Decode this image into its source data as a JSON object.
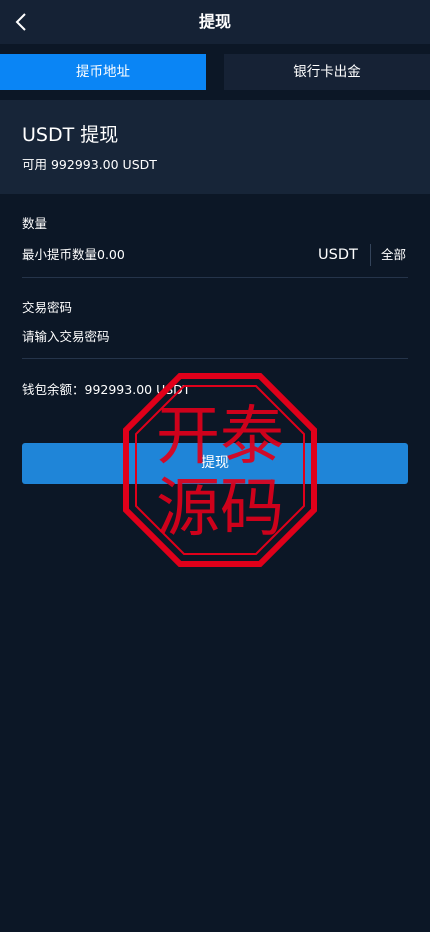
{
  "header": {
    "title": "提现"
  },
  "tabs": [
    {
      "label": "提币地址",
      "active": true
    },
    {
      "label": "银行卡出金",
      "active": false
    }
  ],
  "summary": {
    "title": "USDT 提现",
    "available": "可用 992993.00 USDT"
  },
  "amount": {
    "label": "数量",
    "placeholder": "最小提币数量0.00",
    "unit": "USDT",
    "all_label": "全部"
  },
  "password": {
    "label": "交易密码",
    "placeholder": "请输入交易密码"
  },
  "wallet": {
    "balance_text": "钱包余额：992993.00 USDT"
  },
  "submit": {
    "label": "提现"
  },
  "watermark": {
    "line1": "开泰",
    "line2": "源码"
  },
  "colors": {
    "background": "#0c1726",
    "header": "#152235",
    "tab_active": "#0a85f5",
    "tab_inactive": "#162235",
    "card": "#172538",
    "submit_button": "#1f85d8",
    "seal": "#e0001a"
  }
}
